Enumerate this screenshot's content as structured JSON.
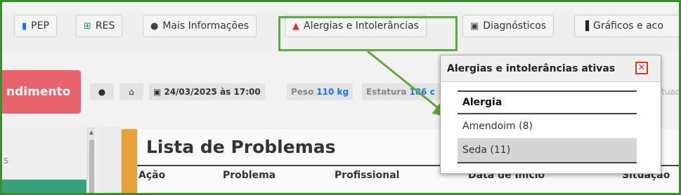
{
  "toolbar": {
    "pep_label": "PEP",
    "res_label": "RES",
    "mais_label": "Mais Informações",
    "alergias_label": "Alergias e Intolerâncias",
    "diag_label": "Diagnósticos",
    "graficos_label": "Gráficos e aco"
  },
  "atendimento_label": "ndimento",
  "patient": {
    "datetime": "24/03/2025 às 17:00",
    "peso_label": "Peso",
    "peso_value": "110 kg",
    "estatura_label": "Estatura",
    "estatura_value": "186 c",
    "situacao_cut": "tuac"
  },
  "sidebar": {
    "cut_text": "s"
  },
  "main": {
    "title": "Lista de Problemas",
    "columns": [
      "Ação",
      "Problema",
      "Profissional",
      "Data de Início",
      "Situação"
    ]
  },
  "popover": {
    "title": "Alergias e intolerâncias ativas",
    "column_header": "Alergia",
    "items": [
      "Amendoim (8)",
      "Seda (11)"
    ]
  },
  "colors": {
    "highlight": "#5fa83a",
    "danger_button": "#e8646c",
    "accent_orange": "#e8a13a",
    "link_blue": "#1a73e8"
  }
}
